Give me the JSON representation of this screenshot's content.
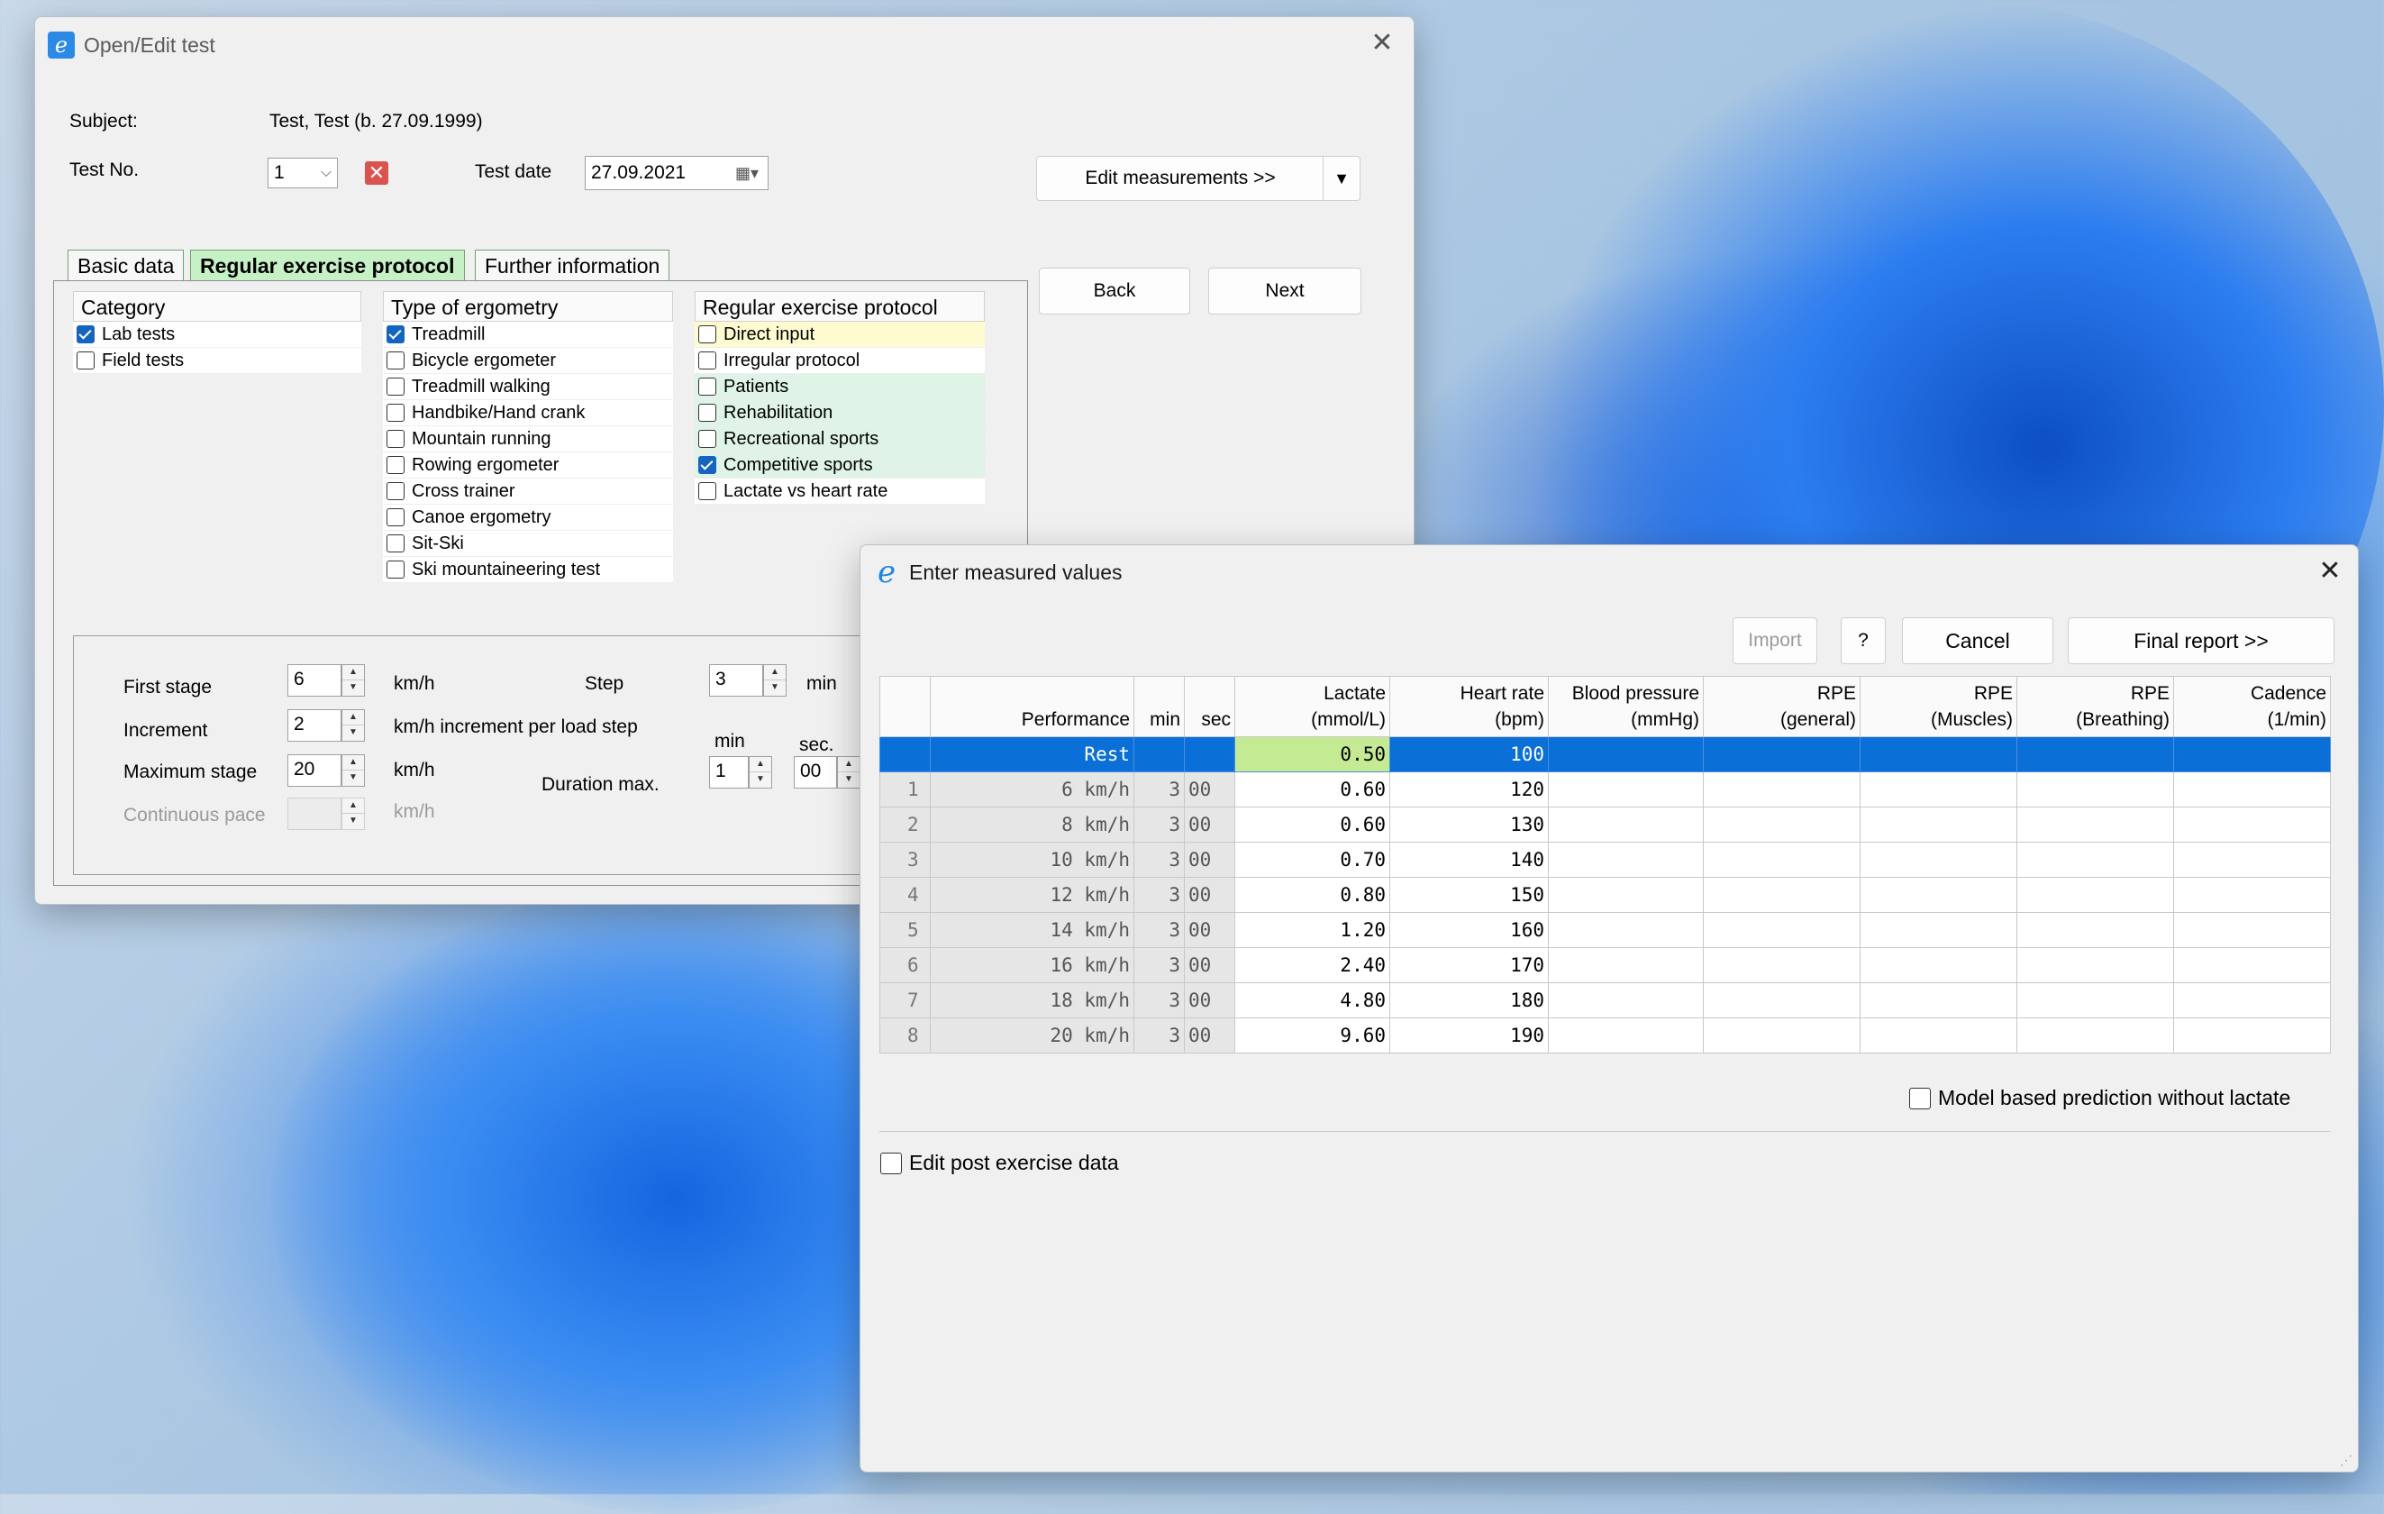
{
  "desktop": {
    "accent": "#1f6fe0"
  },
  "main_window": {
    "title": "Open/Edit test",
    "subject_label": "Subject:",
    "subject_value": "Test, Test (b. 27.09.1999)",
    "testno_label": "Test No.",
    "testno_value": "1",
    "testdate_label": "Test date",
    "testdate_value": "27.09.2021",
    "edit_measurements": "Edit measurements >>",
    "back": "Back",
    "next": "Next",
    "tabs": [
      "Basic data",
      "Regular exercise protocol",
      "Further information"
    ],
    "category": {
      "header": "Category",
      "items": [
        {
          "label": "Lab tests",
          "checked": true
        },
        {
          "label": "Field tests",
          "checked": false
        }
      ]
    },
    "ergometry": {
      "header": "Type of ergometry",
      "items": [
        {
          "label": "Treadmill",
          "checked": true
        },
        {
          "label": "Bicycle ergometer",
          "checked": false
        },
        {
          "label": "Treadmill walking",
          "checked": false
        },
        {
          "label": "Handbike/Hand crank",
          "checked": false
        },
        {
          "label": "Mountain running",
          "checked": false
        },
        {
          "label": "Rowing ergometer",
          "checked": false
        },
        {
          "label": "Cross trainer",
          "checked": false
        },
        {
          "label": "Canoe ergometry",
          "checked": false
        },
        {
          "label": "Sit-Ski",
          "checked": false
        },
        {
          "label": "Ski mountaineering test",
          "checked": false
        }
      ]
    },
    "protocol": {
      "header": "Regular exercise protocol",
      "items": [
        {
          "label": "Direct input",
          "checked": false,
          "shade": "yellow"
        },
        {
          "label": "Irregular protocol",
          "checked": false,
          "shade": "none"
        },
        {
          "label": "Patients",
          "checked": false,
          "shade": "green"
        },
        {
          "label": "Rehabilitation",
          "checked": false,
          "shade": "green"
        },
        {
          "label": "Recreational sports",
          "checked": false,
          "shade": "green"
        },
        {
          "label": "Competitive sports",
          "checked": true,
          "shade": "green"
        },
        {
          "label": "Lactate vs heart rate",
          "checked": false,
          "shade": "none"
        }
      ]
    },
    "stages": {
      "first_stage_label": "First stage",
      "first_stage_value": "6",
      "first_stage_unit": "km/h",
      "increment_label": "Increment",
      "increment_value": "2",
      "increment_unit": "km/h increment per load step",
      "max_stage_label": "Maximum stage",
      "max_stage_value": "20",
      "max_stage_unit": "km/h",
      "continuous_label": "Continuous pace",
      "continuous_unit": "km/h",
      "step_label": "Step",
      "step_value": "3",
      "step_unit": "min",
      "duration_label": "Duration max.",
      "min_label": "min",
      "min_value": "1",
      "sec_label": "sec.",
      "sec_value": "00"
    }
  },
  "measure_window": {
    "title": "Enter measured values",
    "import": "Import",
    "help": "?",
    "cancel": "Cancel",
    "final_report": "Final report >>",
    "columns": [
      {
        "line1": "",
        "line2": "Performance"
      },
      {
        "line1": "",
        "line2": "min"
      },
      {
        "line1": "",
        "line2": "sec"
      },
      {
        "line1": "Lactate",
        "line2": "(mmol/L)"
      },
      {
        "line1": "Heart rate",
        "line2": "(bpm)"
      },
      {
        "line1": "Blood pressure",
        "line2": "(mmHg)"
      },
      {
        "line1": "RPE",
        "line2": "(general)"
      },
      {
        "line1": "RPE",
        "line2": "(Muscles)"
      },
      {
        "line1": "RPE",
        "line2": "(Breathing)"
      },
      {
        "line1": "Cadence",
        "line2": "(1/min)"
      }
    ],
    "rows": [
      {
        "idx": "",
        "perf": "Rest",
        "min": "",
        "sec": "",
        "lactate": "0.50",
        "hr": "100"
      },
      {
        "idx": "1",
        "perf": "6 km/h",
        "min": "3",
        "sec": "00",
        "lactate": "0.60",
        "hr": "120"
      },
      {
        "idx": "2",
        "perf": "8 km/h",
        "min": "3",
        "sec": "00",
        "lactate": "0.60",
        "hr": "130"
      },
      {
        "idx": "3",
        "perf": "10 km/h",
        "min": "3",
        "sec": "00",
        "lactate": "0.70",
        "hr": "140"
      },
      {
        "idx": "4",
        "perf": "12 km/h",
        "min": "3",
        "sec": "00",
        "lactate": "0.80",
        "hr": "150"
      },
      {
        "idx": "5",
        "perf": "14 km/h",
        "min": "3",
        "sec": "00",
        "lactate": "1.20",
        "hr": "160"
      },
      {
        "idx": "6",
        "perf": "16 km/h",
        "min": "3",
        "sec": "00",
        "lactate": "2.40",
        "hr": "170"
      },
      {
        "idx": "7",
        "perf": "18 km/h",
        "min": "3",
        "sec": "00",
        "lactate": "4.80",
        "hr": "180"
      },
      {
        "idx": "8",
        "perf": "20 km/h",
        "min": "3",
        "sec": "00",
        "lactate": "9.60",
        "hr": "190"
      }
    ],
    "model_prediction": "Model based prediction without lactate",
    "post_exercise": "Edit post exercise data"
  }
}
